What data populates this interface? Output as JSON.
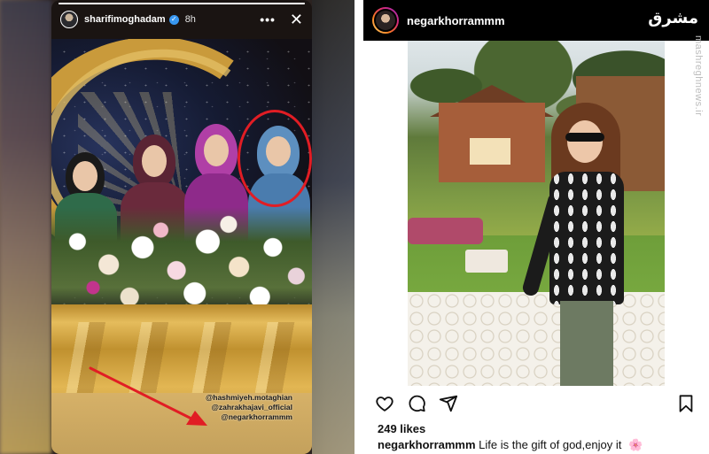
{
  "story": {
    "username": "sharifimoghadam",
    "verified_glyph": "✓",
    "time": "8h",
    "more_glyph": "•••",
    "close_glyph": "✕",
    "progress": 1.0,
    "tags": [
      "@hashmiyeh.motaghian",
      "@zahrakhajavi_official",
      "@negarkhorrammm"
    ],
    "annotation_color": "#e11d24"
  },
  "post": {
    "username": "negarkhorrammm",
    "watermark": "مشرق",
    "watermark_url": "mashreghnews.ir",
    "likes": "249 likes",
    "caption_user": "negarkhorrammm",
    "caption_text": "Life is the gift of god,enjoy it",
    "caption_emoji": "🌸",
    "icons": [
      "heart-icon",
      "comment-icon",
      "share-icon",
      "bookmark-icon"
    ]
  },
  "colors": {
    "header_bg": "#000000",
    "verified": "#3897f0",
    "gold": "#c99a3b"
  }
}
